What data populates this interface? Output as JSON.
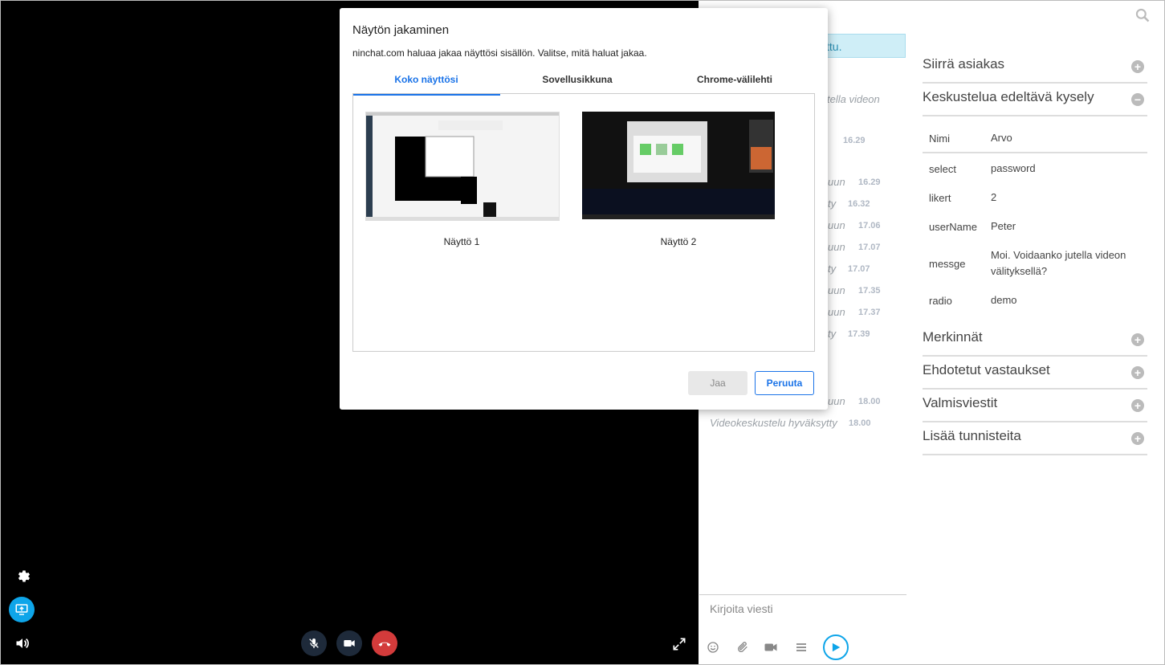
{
  "dialog": {
    "title": "Näytön jakaminen",
    "subtitle": "ninchat.com haluaa jakaa näyttösi sisällön. Valitse, mitä haluat jakaa.",
    "tabs": [
      {
        "label": "Koko näyttösi"
      },
      {
        "label": "Sovellusikkuna"
      },
      {
        "label": "Chrome-välilehti"
      }
    ],
    "screens": [
      {
        "label": "Näyttö 1"
      },
      {
        "label": "Näyttö 2"
      }
    ],
    "share_label": "Jaa",
    "cancel_label": "Peruuta"
  },
  "chat": {
    "notice": "ttu.",
    "messages": [
      {
        "text": "tella videon",
        "time": ""
      },
      {
        "text": "",
        "time": "16.29"
      },
      {
        "text": "uun",
        "time": "16.29"
      },
      {
        "text": "ty",
        "time": "16.32"
      },
      {
        "text": "uun",
        "time": "17.06"
      },
      {
        "text": "uun",
        "time": "17.07"
      },
      {
        "text": "ty",
        "time": "17.07"
      },
      {
        "text": "uun",
        "time": "17.35"
      },
      {
        "text": "uun",
        "time": "17.37"
      },
      {
        "text": "ty",
        "time": "17.39"
      },
      {
        "text": "uun",
        "time": "18.00"
      },
      {
        "text": "Videokeskustelu hyväksytty",
        "time": "18.00"
      }
    ],
    "composer_placeholder": "Kirjoita viesti"
  },
  "panel": {
    "sections_top": [
      {
        "title": "Siirrä asiakas",
        "state": "+"
      },
      {
        "title": "Keskustelua edeltävä kysely",
        "state": "−"
      }
    ],
    "survey": [
      {
        "key": "Nimi",
        "value": "Arvo"
      },
      {
        "key": "select",
        "value": "password"
      },
      {
        "key": "likert",
        "value": "2"
      },
      {
        "key": "userName",
        "value": "Peter"
      },
      {
        "key": "messge",
        "value": "Moi. Voidaanko jutella videon välityksellä?"
      },
      {
        "key": "radio",
        "value": "demo"
      }
    ],
    "sections_bottom": [
      {
        "title": "Merkinnät",
        "state": "+"
      },
      {
        "title": "Ehdotetut vastaukset",
        "state": "+"
      },
      {
        "title": "Valmisviestit",
        "state": "+"
      },
      {
        "title": "Lisää tunnisteita",
        "state": "+"
      }
    ]
  },
  "colors": {
    "accent": "#1a73e8",
    "share_button_active": "#0ea5e9",
    "hangup": "#d33b3b",
    "control_bg": "#1e2a3a"
  }
}
